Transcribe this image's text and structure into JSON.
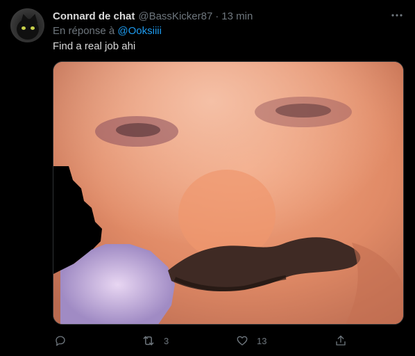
{
  "tweet": {
    "avatar_alt": "black cat avatar",
    "display_name": "Connard de chat",
    "handle": "@BassKicker87",
    "separator": "·",
    "time": "13 min",
    "reply_prefix": "En réponse à",
    "reply_to": "@Ooksiiii",
    "text": "Find a real job ahi",
    "media_kind": "image"
  },
  "actions": {
    "reply": {
      "icon": "reply-icon",
      "count": ""
    },
    "retweet": {
      "icon": "retweet-icon",
      "count": "3"
    },
    "like": {
      "icon": "heart-icon",
      "count": "13"
    },
    "share": {
      "icon": "share-icon"
    }
  },
  "colors": {
    "background": "#000000",
    "text_primary": "#d9d9d9",
    "text_secondary": "#6e767d",
    "link": "#1d9bf0"
  }
}
